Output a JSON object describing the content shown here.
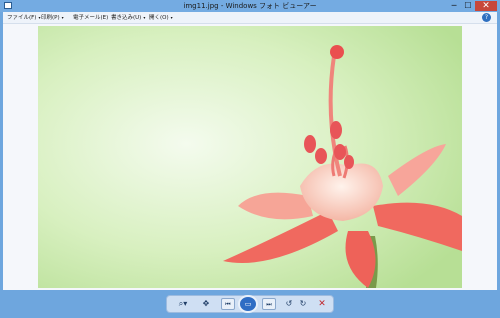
{
  "window": {
    "title": "img11.jpg - Windows フォト ビューアー",
    "min_glyph": "─",
    "max_glyph": "☐",
    "close_glyph": "✕"
  },
  "menu": {
    "items": [
      {
        "label": "ファイル(F)",
        "arrow": "▾"
      },
      {
        "label": "印刷(P)",
        "arrow": "▾"
      },
      {
        "label": "電子メール(E)",
        "arrow": ""
      },
      {
        "label": "書き込み(U)",
        "arrow": "▾"
      },
      {
        "label": "開く(O)",
        "arrow": "▾"
      }
    ],
    "help_glyph": "?"
  },
  "image": {
    "background_color": "#d9f2c1",
    "flower_color": "#f2746b",
    "center_color": "#fbe0d6"
  },
  "toolbar": {
    "zoom_glyph": "⌕▾",
    "fit_glyph": "✥",
    "prev_glyph": "⏮",
    "slideshow_glyph": "▭",
    "next_glyph": "⏭",
    "rotate_left_glyph": "↺",
    "rotate_right_glyph": "↻",
    "delete_glyph": "✕"
  },
  "icons": [
    "app-icon",
    "zoom-icon",
    "fit-window-icon",
    "previous-icon",
    "slideshow-icon",
    "next-icon",
    "rotate-left-icon",
    "rotate-right-icon",
    "delete-icon",
    "help-icon"
  ]
}
